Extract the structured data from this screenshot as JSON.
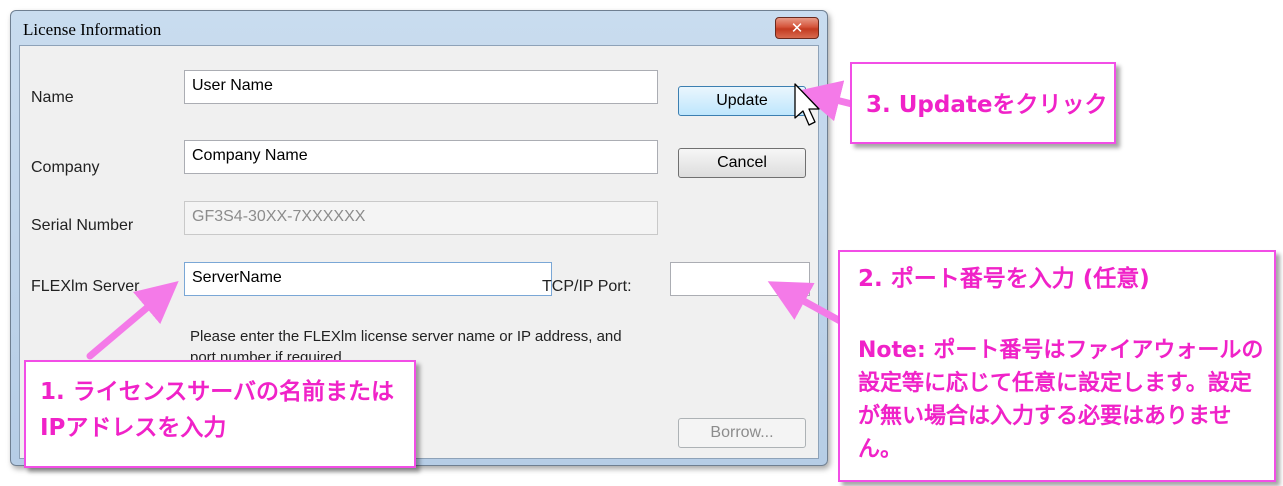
{
  "dialog": {
    "title": "License Information",
    "close_glyph": "✕",
    "fields": {
      "name": {
        "label": "Name",
        "value": "User Name"
      },
      "company": {
        "label": "Company",
        "value": "Company Name"
      },
      "serial": {
        "label": "Serial Number",
        "value": "GF3S4-30XX-7XXXXXX"
      },
      "flexlm": {
        "label": "FLEXlm Server",
        "value": "ServerName"
      },
      "port": {
        "label": "TCP/IP Port:",
        "value": ""
      }
    },
    "help_text": "Please enter the FLEXlm license server name or IP address, and port number if required.",
    "buttons": {
      "update": "Update",
      "cancel": "Cancel",
      "borrow": "Borrow..."
    }
  },
  "callouts": {
    "step1": "1. ライセンスサーバの名前またはIPアドレスを入力",
    "step2_title": "2. ポート番号を入力 (任意)",
    "step2_note": "Note: ポート番号はファイアウォールの設定等に応じて任意に設定します。設定が無い場合は入力する必要はありません。",
    "step3": "3. Updateをクリック"
  },
  "colors": {
    "callout_text": "#f022c8",
    "callout_border": "#f24ee6",
    "arrow": "#f47ae8",
    "titlebar": "#c4d8ee",
    "close_button": "#c7432a"
  },
  "icons": {
    "cursor": "mouse-pointer-icon",
    "close": "close-icon"
  }
}
